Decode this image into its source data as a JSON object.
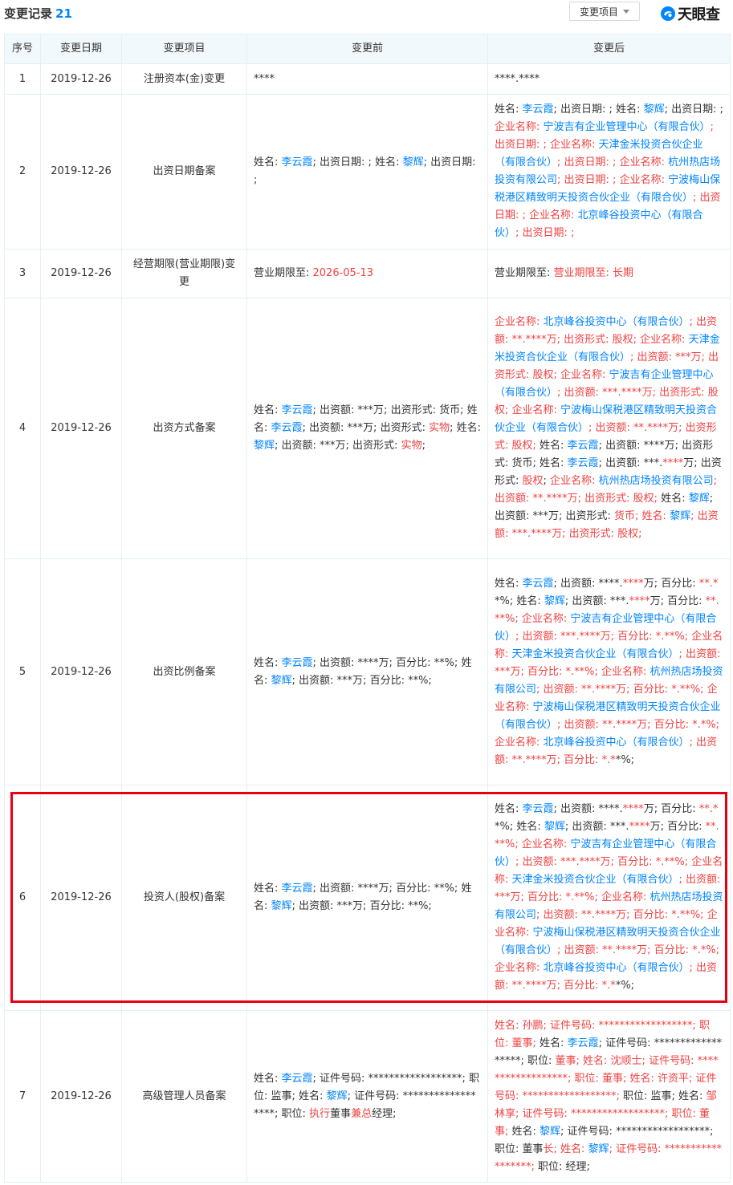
{
  "header": {
    "title": "变更记录",
    "count": "21",
    "filter_label": "变更项目",
    "logo_text": "天眼查",
    "logo_icon": "tianyancha-logo-icon"
  },
  "table": {
    "columns": [
      "序号",
      "变更日期",
      "变更项目",
      "变更前",
      "变更后"
    ],
    "rows": [
      {
        "index": "1",
        "date": "2019-12-26",
        "item": "注册资本(金)变更",
        "before": [
          {
            "t": "****"
          }
        ],
        "after": [
          {
            "t": "****.****"
          }
        ]
      },
      {
        "index": "2",
        "date": "2019-12-26",
        "item": "出资日期备案",
        "before": [
          {
            "t": "姓名: "
          },
          {
            "t": "李云霞",
            "c": "blue"
          },
          {
            "t": "; 出资日期: ; 姓名: "
          },
          {
            "t": "黎辉",
            "c": "blue"
          },
          {
            "t": "; 出资日期: ;"
          }
        ],
        "after": [
          {
            "t": "姓名: "
          },
          {
            "t": "李云霞",
            "c": "blue"
          },
          {
            "t": "; 出资日期: ; 姓名: "
          },
          {
            "t": "黎辉",
            "c": "blue"
          },
          {
            "t": "; 出资日期: ; "
          },
          {
            "t": "企业名称: ",
            "c": "red"
          },
          {
            "t": "宁波吉有企业管理中心（有限合伙）",
            "c": "blue"
          },
          {
            "t": "; 出资日期: ; ",
            "c": "red"
          },
          {
            "t": "企业名称: ",
            "c": "red"
          },
          {
            "t": "天津金米投资合伙企业（有限合伙）",
            "c": "blue"
          },
          {
            "t": "; 出资日期: ; ",
            "c": "red"
          },
          {
            "t": "企业名称: ",
            "c": "red"
          },
          {
            "t": "杭州热店场投资有限公司",
            "c": "blue"
          },
          {
            "t": "; 出资日期: ; ",
            "c": "red"
          },
          {
            "t": "企业名称: ",
            "c": "red"
          },
          {
            "t": "宁波梅山保税港区精致明天投资合伙企业（有限合伙）",
            "c": "blue"
          },
          {
            "t": "; 出资日期: ; ",
            "c": "red"
          },
          {
            "t": "企业名称: ",
            "c": "red"
          },
          {
            "t": "北京峰谷投资中心（有限合伙）",
            "c": "blue"
          },
          {
            "t": "; 出资日期: ;",
            "c": "red"
          }
        ]
      },
      {
        "index": "3",
        "date": "2019-12-26",
        "item": "经营期限(营业期限)变更",
        "before": [
          {
            "t": "营业期限至: "
          },
          {
            "t": "2026-05-13",
            "c": "red"
          }
        ],
        "after": [
          {
            "t": "营业期限至: "
          },
          {
            "t": "营业期限至: 长期",
            "c": "red"
          }
        ]
      },
      {
        "index": "4",
        "date": "2019-12-26",
        "item": "出资方式备案",
        "before": [
          {
            "t": "姓名: "
          },
          {
            "t": "李云霞",
            "c": "blue"
          },
          {
            "t": "; 出资额: ***万; 出资形式: 货币; 姓名: "
          },
          {
            "t": "李云霞",
            "c": "blue"
          },
          {
            "t": "; 出资额: ***万; 出资形式: "
          },
          {
            "t": "实物",
            "c": "red"
          },
          {
            "t": "; 姓名: "
          },
          {
            "t": "黎辉",
            "c": "blue"
          },
          {
            "t": "; 出资额: ***万; 出资形式: "
          },
          {
            "t": "实物",
            "c": "red"
          },
          {
            "t": ";"
          }
        ],
        "after": [
          {
            "t": "企业名称: ",
            "c": "red"
          },
          {
            "t": "北京峰谷投资中心（有限合伙）",
            "c": "blue"
          },
          {
            "t": "; 出资额: **.****万; 出资形式: 股权; 企业名称: ",
            "c": "red"
          },
          {
            "t": "天津金米投资合伙企业（有限合伙）",
            "c": "blue"
          },
          {
            "t": "; 出资额: ***万; 出资形式: 股权; 企业名称: ",
            "c": "red"
          },
          {
            "t": "宁波吉有企业管理中心（有限合伙）",
            "c": "blue"
          },
          {
            "t": "; 出资额: ***.****万; 出资形式: 股权; 企业名称: ",
            "c": "red"
          },
          {
            "t": "宁波梅山保税港区精致明天投资合伙企业（有限合伙）",
            "c": "blue"
          },
          {
            "t": "; 出资额: **.****万; 出资形式: 股权; ",
            "c": "red"
          },
          {
            "t": "姓名: "
          },
          {
            "t": "李云霞",
            "c": "blue"
          },
          {
            "t": "; 出资额: ****万; 出资形式: 货币; 姓名: "
          },
          {
            "t": "李云霞",
            "c": "blue"
          },
          {
            "t": "; 出资额: ***."
          },
          {
            "t": "****",
            "c": "red"
          },
          {
            "t": "万; 出资形式: "
          },
          {
            "t": "股权",
            "c": "red"
          },
          {
            "t": "; "
          },
          {
            "t": "企业名称: ",
            "c": "red"
          },
          {
            "t": "杭州热店场投资有限公司",
            "c": "blue"
          },
          {
            "t": "; 出资额: **.****万; 出资形式: 股权; ",
            "c": "red"
          },
          {
            "t": "姓名: "
          },
          {
            "t": "黎辉",
            "c": "blue"
          },
          {
            "t": "; 出资额: ***万; 出资形式: "
          },
          {
            "t": "货币; 姓名: ",
            "c": "red"
          },
          {
            "t": "黎辉",
            "c": "blue"
          },
          {
            "t": "; 出资额: ***.****万; 出资形式: 股权;",
            "c": "red"
          }
        ]
      },
      {
        "index": "5",
        "date": "2019-12-26",
        "item": "出资比例备案",
        "before": [
          {
            "t": "姓名: "
          },
          {
            "t": "李云霞",
            "c": "blue"
          },
          {
            "t": "; 出资额: ****万; 百分比: **%; 姓名: "
          },
          {
            "t": "黎辉",
            "c": "blue"
          },
          {
            "t": "; 出资额: ***万; 百分比: **%;"
          }
        ],
        "after": [
          {
            "t": "姓名: "
          },
          {
            "t": "李云霞",
            "c": "blue"
          },
          {
            "t": "; 出资额: ****."
          },
          {
            "t": "****",
            "c": "red"
          },
          {
            "t": "万; 百分比: "
          },
          {
            "t": "**.*",
            "c": "red"
          },
          {
            "t": "*%; 姓名: "
          },
          {
            "t": "黎辉",
            "c": "blue"
          },
          {
            "t": "; 出资额: ***."
          },
          {
            "t": "****",
            "c": "red"
          },
          {
            "t": "万; 百分比: "
          },
          {
            "t": "**.**%; 企业名称: ",
            "c": "red"
          },
          {
            "t": "宁波吉有企业管理中心（有限合伙）",
            "c": "blue"
          },
          {
            "t": "; 出资额: ***.****万; 百分比: *.**%; 企业名称: ",
            "c": "red"
          },
          {
            "t": "天津金米投资合伙企业（有限合伙）",
            "c": "blue"
          },
          {
            "t": "; 出资额: ***万; 百分比: *.**%; 企业名称: ",
            "c": "red"
          },
          {
            "t": "杭州热店场投资有限公司",
            "c": "blue"
          },
          {
            "t": "; 出资额: **.****万; 百分比: *.**%; 企业名称: ",
            "c": "red"
          },
          {
            "t": "宁波梅山保税港区精致明天投资合伙企业（有限合伙）",
            "c": "blue"
          },
          {
            "t": "; 出资额: **.****万; 百分比: *.*%; 企业名称: ",
            "c": "red"
          },
          {
            "t": "北京峰谷投资中心（有限合伙）",
            "c": "blue"
          },
          {
            "t": "; 出资额: **.****万; 百分比: *.*",
            "c": "red"
          },
          {
            "t": "*%;"
          }
        ]
      },
      {
        "index": "6",
        "date": "2019-12-26",
        "item": "投资人(股权)备案",
        "before": [
          {
            "t": "姓名: "
          },
          {
            "t": "李云霞",
            "c": "blue"
          },
          {
            "t": "; 出资额: ****万; 百分比: **%; 姓名: "
          },
          {
            "t": "黎辉",
            "c": "blue"
          },
          {
            "t": "; 出资额: ***万; 百分比: **%;"
          }
        ],
        "after": [
          {
            "t": "姓名: "
          },
          {
            "t": "李云霞",
            "c": "blue"
          },
          {
            "t": "; 出资额: ****."
          },
          {
            "t": "****",
            "c": "red"
          },
          {
            "t": "万; 百分比: "
          },
          {
            "t": "**.*",
            "c": "red"
          },
          {
            "t": "*%; 姓名: "
          },
          {
            "t": "黎辉",
            "c": "blue"
          },
          {
            "t": "; 出资额: ***."
          },
          {
            "t": "****",
            "c": "red"
          },
          {
            "t": "万; 百分比: "
          },
          {
            "t": "**.**%; 企业名称: ",
            "c": "red"
          },
          {
            "t": "宁波吉有企业管理中心（有限合伙）",
            "c": "blue"
          },
          {
            "t": "; 出资额: ***.****万; 百分比: *.**%; 企业名称: ",
            "c": "red"
          },
          {
            "t": "天津金米投资合伙企业（有限合伙）",
            "c": "blue"
          },
          {
            "t": "; 出资额: ***万; 百分比: *.**%; 企业名称: ",
            "c": "red"
          },
          {
            "t": "杭州热店场投资有限公司",
            "c": "blue"
          },
          {
            "t": "; 出资额: **.****万; 百分比: *.**%; 企业名称: ",
            "c": "red"
          },
          {
            "t": "宁波梅山保税港区精致明天投资合伙企业（有限合伙）",
            "c": "blue"
          },
          {
            "t": "; 出资额: **.****万; 百分比: *.*%; 企业名称: ",
            "c": "red"
          },
          {
            "t": "北京峰谷投资中心（有限合伙）",
            "c": "blue"
          },
          {
            "t": "; 出资额: **.****万; 百分比: *.*",
            "c": "red"
          },
          {
            "t": "*%;"
          }
        ]
      },
      {
        "index": "7",
        "date": "2019-12-26",
        "item": "高级管理人员备案",
        "before": [
          {
            "t": "姓名: "
          },
          {
            "t": "李云霞",
            "c": "blue"
          },
          {
            "t": "; 证件号码: ******************; 职位: 监事; 姓名: "
          },
          {
            "t": "黎辉",
            "c": "blue"
          },
          {
            "t": "; 证件号码: ******************; 职位: "
          },
          {
            "t": "执行",
            "c": "red"
          },
          {
            "t": "董事"
          },
          {
            "t": "兼总",
            "c": "red"
          },
          {
            "t": "经理;"
          }
        ],
        "after": [
          {
            "t": "姓名: 孙鹏; 证件号码: ******************; 职位: 董事; ",
            "c": "red"
          },
          {
            "t": "姓名: "
          },
          {
            "t": "李云霞",
            "c": "blue"
          },
          {
            "t": "; 证件号码: ******************; 职位: "
          },
          {
            "t": "董事; 姓名: 沈顺士; 证件号码: ******************; 职位: 董事; 姓名: 许资平; 证件号码: ******************; ",
            "c": "red"
          },
          {
            "t": "职位: 监事; 姓名: "
          },
          {
            "t": "邹林享; 证件号码: ******************; 职位: 董事; ",
            "c": "red"
          },
          {
            "t": "姓名: "
          },
          {
            "t": "黎辉",
            "c": "blue"
          },
          {
            "t": "; 证件号码: ******************; 职位: 董事"
          },
          {
            "t": "长; 姓名: ",
            "c": "red"
          },
          {
            "t": "黎辉",
            "c": "blue"
          },
          {
            "t": "; 证件号码: ******************; ",
            "c": "red"
          },
          {
            "t": "职位: 经理;"
          }
        ]
      }
    ]
  }
}
